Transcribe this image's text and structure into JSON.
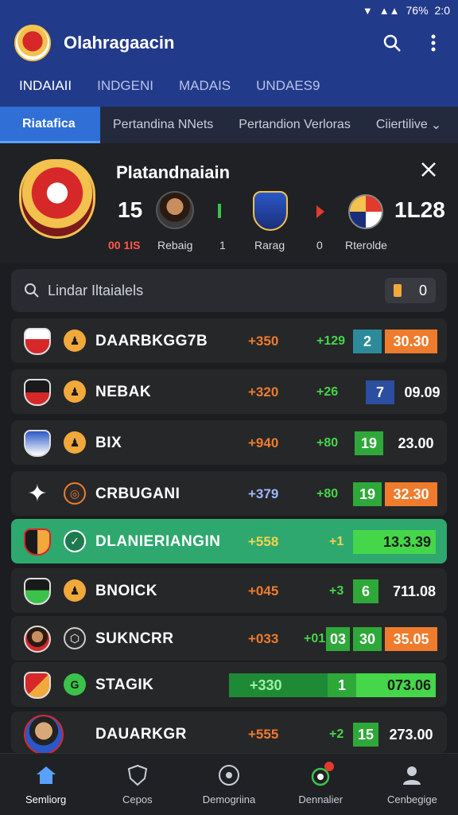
{
  "status": {
    "time": "2:0",
    "battery": "76%"
  },
  "header": {
    "title": "Olahragaacin",
    "logo_icon": "club-crest-icon",
    "actions": [
      "search-icon",
      "more-vert-icon"
    ]
  },
  "top_tabs": [
    {
      "label": "INDAIAII",
      "active": true
    },
    {
      "label": "INDGENI",
      "active": false
    },
    {
      "label": "MADAIS",
      "active": false
    },
    {
      "label": "UNDAES9",
      "active": false
    }
  ],
  "sub_tabs": [
    {
      "label": "Riatafica",
      "active": true
    },
    {
      "label": "Pertandina NNets",
      "active": false
    },
    {
      "label": "Pertandion Verloras",
      "active": false
    },
    {
      "label": "Ciiertilive",
      "active": false
    }
  ],
  "match": {
    "title": "Platandnaiain",
    "score_left": "15",
    "score_right": "1L28",
    "sub_left": "00 1IS",
    "sub_player": "Rebaig",
    "sub_a": "1",
    "sub_team": "Rarag",
    "sub_b": "0",
    "sub_right": "Rterolde"
  },
  "search": {
    "placeholder": "Lindar Iltaialels",
    "filter_count": "0"
  },
  "rows": [
    {
      "name": "DAARBKGG7B",
      "odds1": "+350",
      "odds2": "+129",
      "box": "2",
      "value": "30.30"
    },
    {
      "name": "NEBAK",
      "odds1": "+320",
      "odds2": "+26",
      "box": "7",
      "value": "09.09"
    },
    {
      "name": "BIX",
      "odds1": "+940",
      "odds2": "+80",
      "box": "19",
      "value": "23.00"
    },
    {
      "name": "CRBUGANI",
      "odds1": "+379",
      "odds2": "+80",
      "box": "19",
      "value": "32.30"
    },
    {
      "name": "DLANIERIANGIN",
      "odds1": "+558",
      "odds2": "+1",
      "box": "",
      "value": "13.3.39"
    },
    {
      "name": "BNOICK",
      "odds1": "+045",
      "odds2": "+3",
      "box": "6",
      "value": "711.08"
    },
    {
      "name": "SUKNCRR",
      "odds1": "+033",
      "odds2": "+01",
      "box": "03",
      "box2": "30",
      "value": "35.05"
    },
    {
      "name": "STAGIK",
      "odds1": "+330",
      "odds2": "1",
      "box": "",
      "value": "073.06"
    },
    {
      "name": "DAUARKGR",
      "odds1": "+555",
      "odds2": "+2",
      "box": "15",
      "value": "273.00"
    }
  ],
  "bottom_nav": [
    {
      "label": "Semliorg",
      "icon": "home-icon",
      "active": true
    },
    {
      "label": "Cepos",
      "icon": "shield-icon",
      "active": false
    },
    {
      "label": "Demogriina",
      "icon": "ball-icon",
      "active": false
    },
    {
      "label": "Dennalier",
      "icon": "notifications-icon",
      "active": false
    },
    {
      "label": "Cenbegige",
      "icon": "profile-icon",
      "active": false
    }
  ],
  "colors": {
    "header_bg": "#223a8a",
    "tab_active": "#2f6fd6",
    "accent_green": "#3ac24a",
    "accent_orange": "#ef7b2c",
    "accent_blue_box": "#2b5cbf",
    "highlight_row": "#2ea86f"
  }
}
